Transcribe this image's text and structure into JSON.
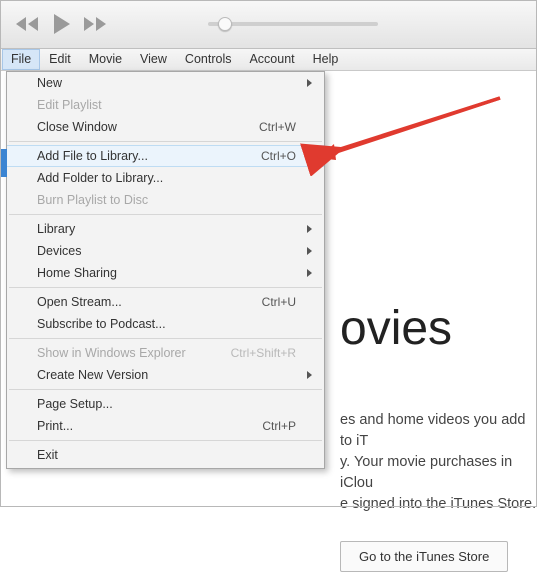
{
  "menubar": {
    "items": [
      "File",
      "Edit",
      "Movie",
      "View",
      "Controls",
      "Account",
      "Help"
    ],
    "open_index": 0
  },
  "dropdown": [
    {
      "label": "New",
      "submenu": true
    },
    {
      "label": "Edit Playlist",
      "disabled": true
    },
    {
      "label": "Close Window",
      "shortcut": "Ctrl+W"
    },
    {
      "sep": true
    },
    {
      "label": "Add File to Library...",
      "shortcut": "Ctrl+O",
      "highlight": true
    },
    {
      "label": "Add Folder to Library..."
    },
    {
      "label": "Burn Playlist to Disc",
      "disabled": true
    },
    {
      "sep": true
    },
    {
      "label": "Library",
      "submenu": true
    },
    {
      "label": "Devices",
      "submenu": true
    },
    {
      "label": "Home Sharing",
      "submenu": true
    },
    {
      "sep": true
    },
    {
      "label": "Open Stream...",
      "shortcut": "Ctrl+U"
    },
    {
      "label": "Subscribe to Podcast..."
    },
    {
      "sep": true
    },
    {
      "label": "Show in Windows Explorer",
      "shortcut": "Ctrl+Shift+R",
      "disabled": true
    },
    {
      "label": "Create New Version",
      "submenu": true
    },
    {
      "sep": true
    },
    {
      "label": "Page Setup..."
    },
    {
      "label": "Print...",
      "shortcut": "Ctrl+P"
    },
    {
      "sep": true
    },
    {
      "label": "Exit"
    }
  ],
  "content": {
    "heading": "ovies",
    "paragraph_line1": "es and home videos you add to iT",
    "paragraph_line2": "y. Your movie purchases in iClou",
    "paragraph_line3": "e signed into the iTunes Store.",
    "store_button": "Go to the iTunes Store"
  },
  "annotation": {
    "arrow_color": "#e03a2f"
  }
}
